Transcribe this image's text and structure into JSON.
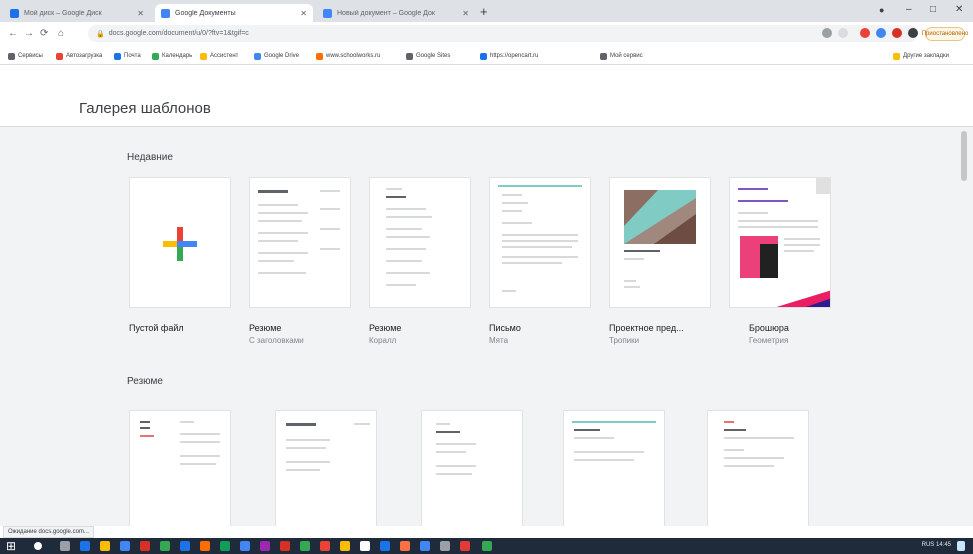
{
  "window": {
    "tabs": [
      {
        "title": "Мой диск – Google Диск",
        "favicon_color": "#1a73e8",
        "active": false
      },
      {
        "title": "Google Документы",
        "favicon_color": "#4285f4",
        "active": true
      },
      {
        "title": "Новый документ – Google Док",
        "favicon_color": "#4285f4",
        "active": false
      }
    ],
    "new_tab_label": "+",
    "controls": {
      "minimize": "–",
      "maximize": "□",
      "close": "✕"
    }
  },
  "toolbar": {
    "back": "←",
    "forward": "→",
    "reload": "⟳",
    "home": "⌂",
    "url": "docs.google.com/document/u/0/?ftv=1&tgif=c",
    "profile_label": "Приостановлено"
  },
  "bookmarks": [
    {
      "label": "Сервисы",
      "color": "#5f6368"
    },
    {
      "label": "Автозагрузка",
      "color": "#ea4335"
    },
    {
      "label": "Почта",
      "color": "#1a73e8"
    },
    {
      "label": "Календарь",
      "color": "#34a853"
    },
    {
      "label": "Ассистент",
      "color": "#fbbc04"
    },
    {
      "label": "Google Drive",
      "color": "#4285f4"
    },
    {
      "label": "www.schoolworks.ru",
      "color": "#ff6d00"
    },
    {
      "label": "Google Sites",
      "color": "#5f6368"
    },
    {
      "label": "https://opencart.ru",
      "color": "#1a73e8"
    },
    {
      "label": "Мой сервис",
      "color": "#5f6368"
    },
    {
      "label": "Другие закладки",
      "color": "#fbbc04"
    }
  ],
  "page": {
    "title": "Галерея шаблонов",
    "sections": [
      {
        "title": "Недавние",
        "templates": [
          {
            "name": "Пустой файл",
            "subtitle": ""
          },
          {
            "name": "Резюме",
            "subtitle": "С заголовками"
          },
          {
            "name": "Резюме",
            "subtitle": "Коралл"
          },
          {
            "name": "Письмо",
            "subtitle": "Мята"
          },
          {
            "name": "Проектное пред...",
            "subtitle": "Тропики"
          },
          {
            "name": "Брошюра",
            "subtitle": "Геометрия"
          }
        ]
      },
      {
        "title": "Резюме",
        "templates": []
      }
    ]
  },
  "status_bar": "Ожидание docs.google.com...",
  "taskbar": {
    "start": "⊞",
    "time": "RUS 14:45"
  },
  "colors": {
    "chrome_bg": "#dee1e6",
    "content_bg": "#f1f3f4",
    "accent_teal": "#80cbc4",
    "brochure_pink": "#e91e63",
    "plus_blue": "#4285f4",
    "plus_red": "#ea4335",
    "plus_yellow": "#fbbc04",
    "plus_green": "#34a853"
  }
}
